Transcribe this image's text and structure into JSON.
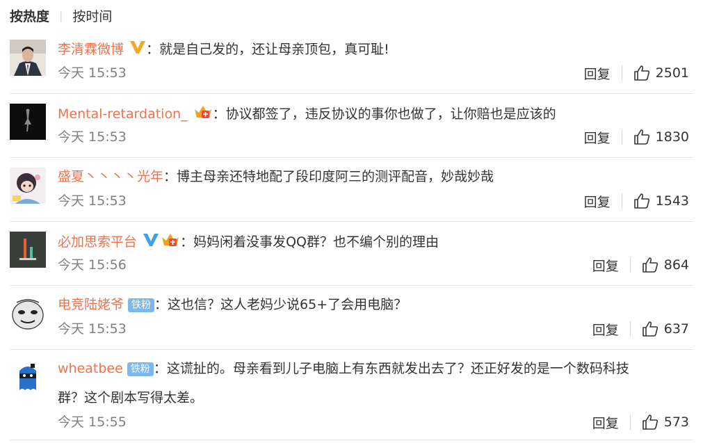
{
  "sort": {
    "hot_label": "按热度",
    "time_label": "按时间"
  },
  "comments": [
    {
      "username": "李清霖微博",
      "badges": [
        "v-gold"
      ],
      "text": "就是自己发的，还让母亲顶包，真可耻!",
      "time": "今天 15:53",
      "reply_label": "回复",
      "likes": "2501"
    },
    {
      "username": "Mental-retardation_",
      "badges": [
        "crown"
      ],
      "text": "协议都签了，违反协议的事你也做了，让你赔也是应该的",
      "time": "今天 15:53",
      "reply_label": "回复",
      "likes": "1830"
    },
    {
      "username": "盛夏丶丶丶丶光年",
      "badges": [],
      "text": "博主母亲还特地配了段印度阿三的测评配音，妙哉妙哉",
      "time": "今天 15:53",
      "reply_label": "回复",
      "likes": "1543"
    },
    {
      "username": "必加思索平台",
      "badges": [
        "v-blue",
        "crown"
      ],
      "text": "妈妈闲着没事发QQ群？也不编个别的理由",
      "time": "今天 15:56",
      "reply_label": "回复",
      "likes": "864"
    },
    {
      "username": "电竞陆姥爷",
      "badges": [
        "fan"
      ],
      "fan_label": "铁粉",
      "text": "这也信？这人老妈少说65+了会用电脑？",
      "time": "今天 15:53",
      "reply_label": "回复",
      "likes": "637"
    },
    {
      "username": "wheatbee",
      "badges": [
        "fan"
      ],
      "fan_label": "铁粉",
      "text": "这谎扯的。母亲看到儿子电脑上有东西就发出去了？还正好发的是一个数码科技",
      "text_line2": "群？这个剧本写得太差。",
      "time": "今天 15:55",
      "reply_label": "回复",
      "likes": "573"
    }
  ],
  "colors": {
    "username": "#eb7350",
    "time": "#808080",
    "text": "#333333",
    "fan_badge": "#7cb8ec",
    "v_gold": "#f5a623",
    "v_blue": "#3fa0e6"
  },
  "icons": [
    "like-thumb-icon",
    "v-verified-icon",
    "crown-member-icon"
  ]
}
